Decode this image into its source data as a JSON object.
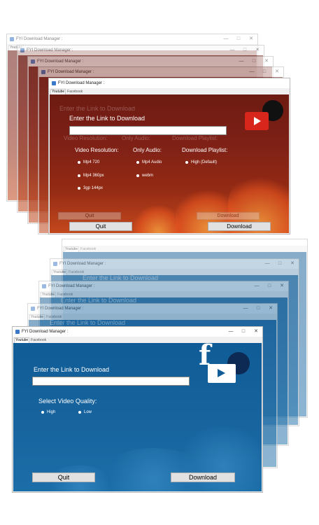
{
  "app": {
    "title": "FYI Download Manager :",
    "minimize": "—",
    "maximize": "□",
    "close": "✕"
  },
  "tabs": {
    "youtube": "Youtube",
    "facebook": "Facebook"
  },
  "youtube_view": {
    "heading": "Enter the Link to Download",
    "url_value": "",
    "video_resolution_label": "Video Resolution:",
    "only_audio_label": "Only Audio:",
    "playlist_label": "Download Playlist:",
    "video_options": [
      "Mp4 720",
      "Mp4 360px",
      "3gp 144px"
    ],
    "audio_options": [
      "Mp4 Audio",
      "webm"
    ],
    "playlist_options": [
      "High (Default)"
    ],
    "quit": "Quit",
    "download": "Download",
    "ghost_heading": "Enter the Link to Download",
    "ghost_quit": "Quit",
    "ghost_download": "Download"
  },
  "facebook_view": {
    "heading": "Enter the Link to Download",
    "url_value": "",
    "quality_label": "Select Video Quality:",
    "quality_options": [
      "High",
      "Low"
    ],
    "quit": "Quit",
    "download": "Download",
    "ghost_heading": "Enter the Link to Download"
  },
  "logo_letter": "f",
  "colors": {
    "red_bg": "#7e2016",
    "blue_bg": "#17649f",
    "logo_red": "#d9261c"
  }
}
